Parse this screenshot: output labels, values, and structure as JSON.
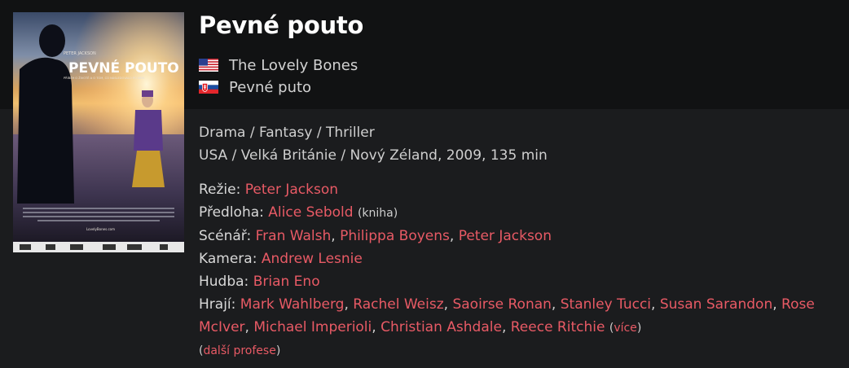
{
  "poster": {
    "director_credit": "PETER JACKSON",
    "title_text": "PEVNÉ POUTO",
    "tagline": "PŘÍBĚH O ŽIVOTĚ A O TOM, CO NÁSLEDOVALO PO NĚM.",
    "website": "LovelyBones.com"
  },
  "film": {
    "title": "Pevné pouto",
    "alt_titles": [
      {
        "flag": "us-flag",
        "title": "The Lovely Bones"
      },
      {
        "flag": "sk-flag",
        "title": "Pevné puto"
      }
    ],
    "genres": "Drama / Fantasy / Thriller",
    "origin": "USA / Velká Británie / Nový Zéland, 2009, 135 min"
  },
  "credits": {
    "directing": {
      "label": "Režie:",
      "people": [
        "Peter Jackson"
      ]
    },
    "source": {
      "label": "Předloha:",
      "people": [
        "Alice Sebold"
      ],
      "note": "(kniha)"
    },
    "screenplay": {
      "label": "Scénář:",
      "people": [
        "Fran Walsh",
        "Philippa Boyens",
        "Peter Jackson"
      ]
    },
    "camera": {
      "label": "Kamera:",
      "people": [
        "Andrew Lesnie"
      ]
    },
    "music": {
      "label": "Hudba:",
      "people": [
        "Brian Eno"
      ]
    },
    "cast": {
      "label": "Hrají:",
      "people": [
        "Mark Wahlberg",
        "Rachel Weisz",
        "Saoirse Ronan",
        "Stanley Tucci",
        "Susan Sarandon",
        "Rose McIver",
        "Michael Imperioli",
        "Christian Ashdale",
        "Reece Ritchie"
      ],
      "more_label": "více"
    },
    "more_professions_label": "další profese"
  },
  "colors": {
    "link": "#e85a65",
    "background": "#1b1c1e",
    "header": "#111213"
  }
}
